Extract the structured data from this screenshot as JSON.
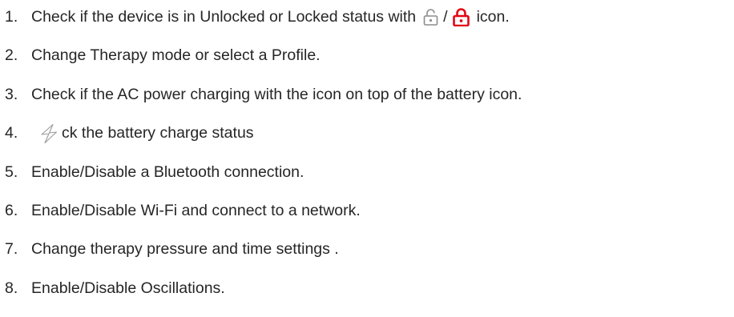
{
  "steps": [
    {
      "number": "1.",
      "text_before": "Check if the device is in Unlocked or Locked status with",
      "separator": "/",
      "text_after": "icon.",
      "icons": [
        "unlocked-padlock-icon",
        "locked-padlock-icon"
      ]
    },
    {
      "number": "2.",
      "text": "Change Therapy mode or select a Profile."
    },
    {
      "number": "3.",
      "text": "Check if the AC power charging with the icon on top of the battery icon."
    },
    {
      "number": "4.",
      "icons": [
        "lightning-bolt-icon"
      ],
      "text": "ck the battery charge status"
    },
    {
      "number": "5.",
      "text": "Enable/Disable a Bluetooth connection."
    },
    {
      "number": "6.",
      "text": "Enable/Disable Wi-Fi and connect to a network."
    },
    {
      "number": "7.",
      "text": "Change therapy pressure and time settings ."
    },
    {
      "number": "8.",
      "text": "Enable/Disable Oscillations."
    }
  ],
  "colors": {
    "text": "#262626",
    "unlocked_icon": "#8c8c8c",
    "locked_icon": "#e30613",
    "bolt_icon": "#9a9a9a"
  }
}
